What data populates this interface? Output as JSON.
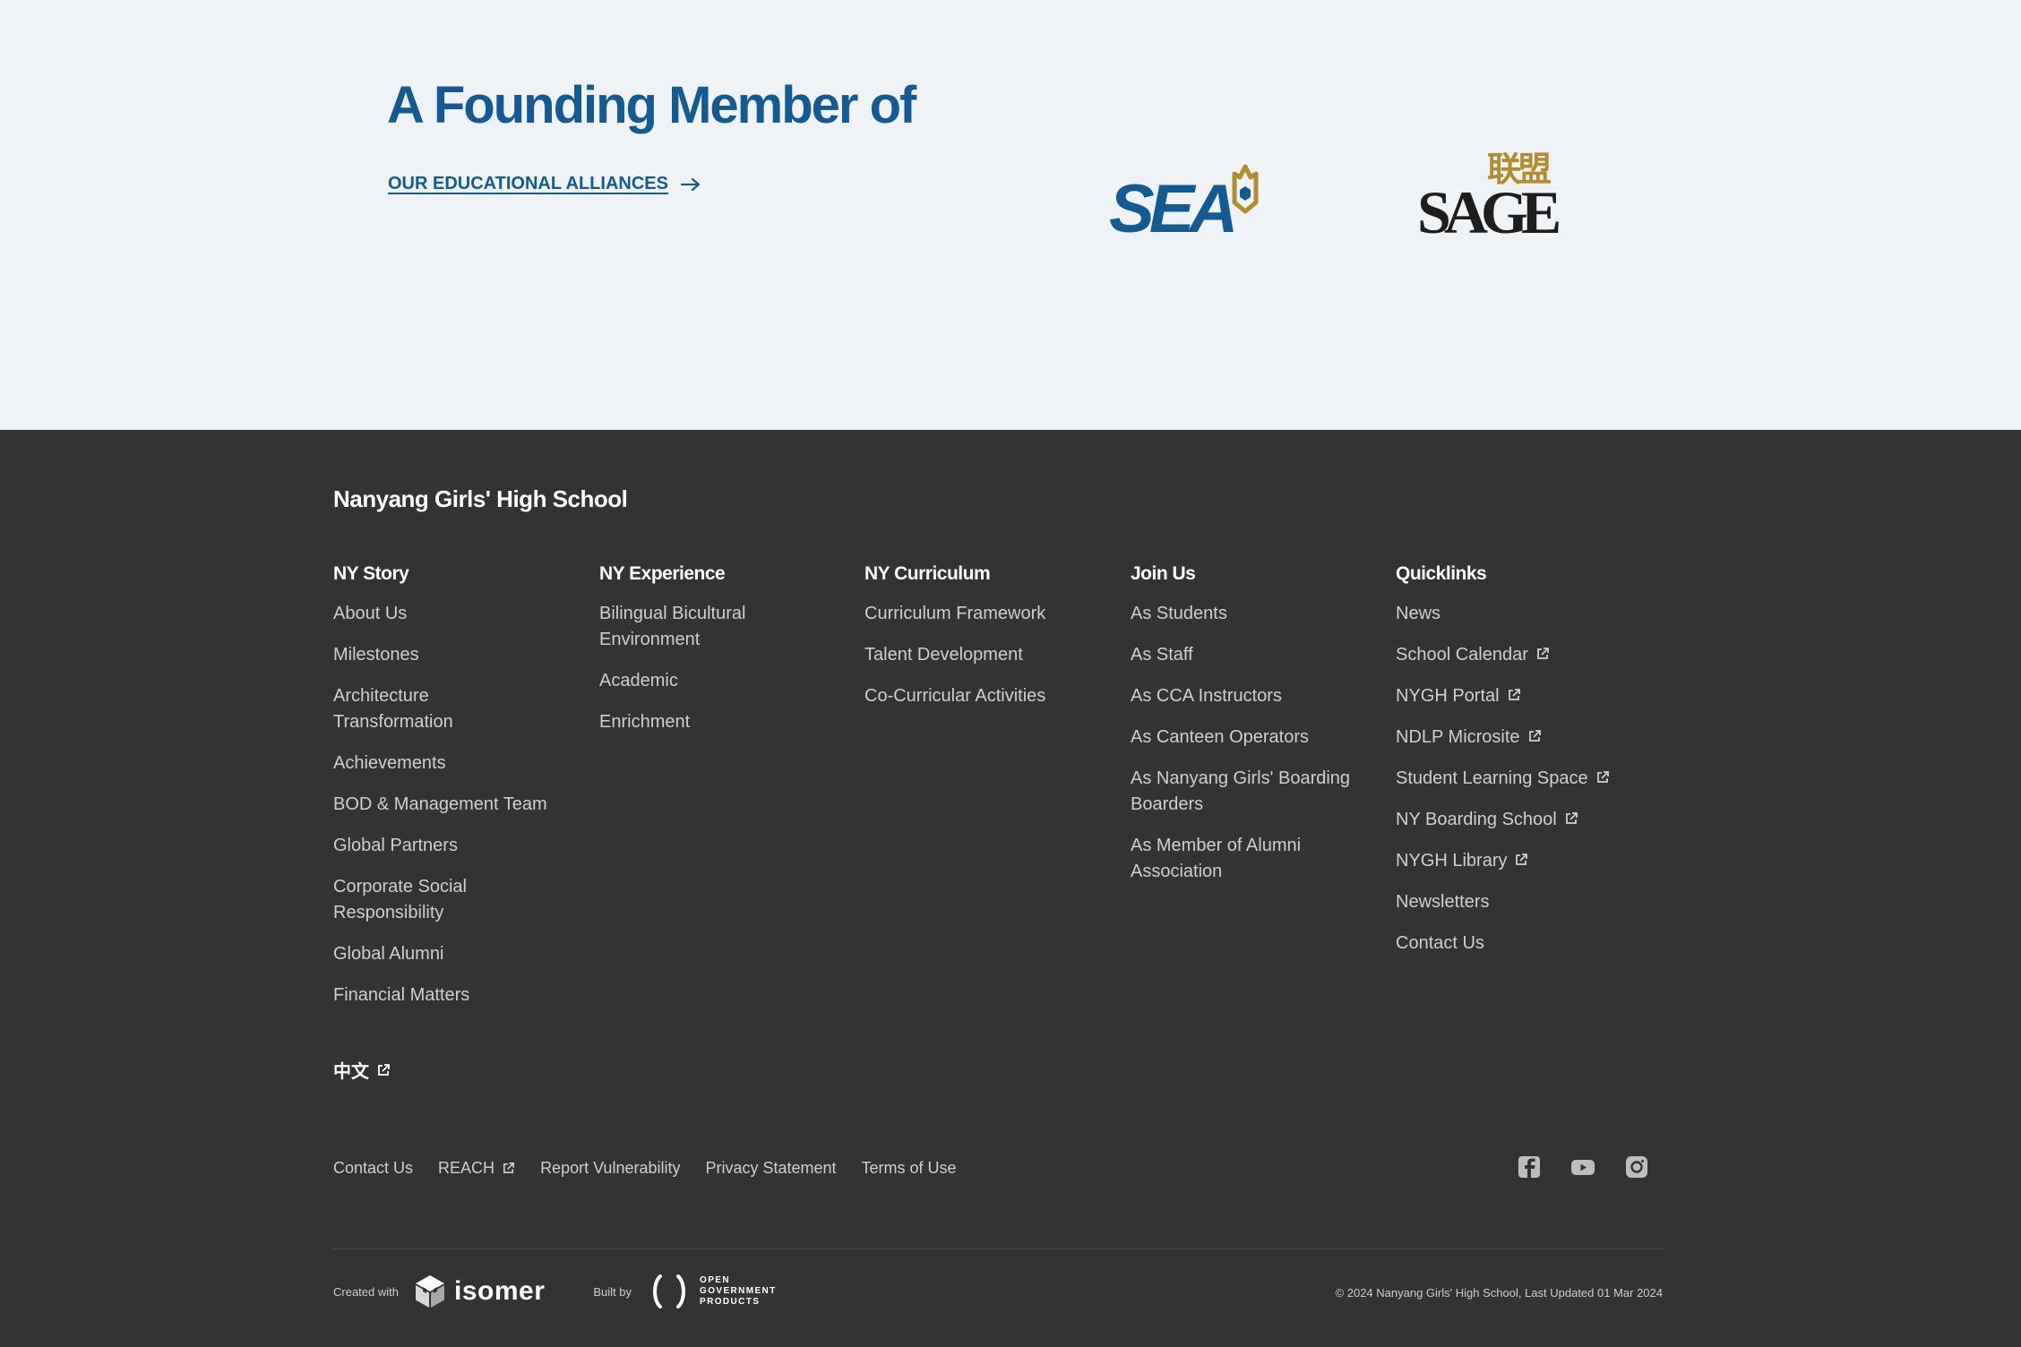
{
  "alliance": {
    "title": "A Founding Member of",
    "link_label": "OUR EDUCATIONAL ALLIANCES",
    "logos": [
      {
        "name": "SEA",
        "text": "SEA"
      },
      {
        "name": "SAGE",
        "text": "SAGE",
        "cjk": "联盟"
      }
    ],
    "brand_color": "#155a92",
    "gold_color": "#b08d2e"
  },
  "footer": {
    "school_name": "Nanyang Girls' High School",
    "columns": [
      {
        "heading": "NY Story",
        "items": [
          {
            "label": "About Us"
          },
          {
            "label": "Milestones"
          },
          {
            "label": "Architecture Transformation"
          },
          {
            "label": "Achievements"
          },
          {
            "label": "BOD & Management Team"
          },
          {
            "label": "Global Partners"
          },
          {
            "label": "Corporate Social Responsibility"
          },
          {
            "label": "Global Alumni"
          },
          {
            "label": "Financial Matters"
          }
        ]
      },
      {
        "heading": "NY Experience",
        "items": [
          {
            "label": "Bilingual Bicultural Environment"
          },
          {
            "label": "Academic"
          },
          {
            "label": "Enrichment"
          }
        ]
      },
      {
        "heading": "NY Curriculum",
        "items": [
          {
            "label": "Curriculum Framework"
          },
          {
            "label": "Talent Development"
          },
          {
            "label": "Co-Curricular Activities"
          }
        ]
      },
      {
        "heading": "Join Us",
        "items": [
          {
            "label": "As Students"
          },
          {
            "label": "As Staff"
          },
          {
            "label": "As CCA Instructors"
          },
          {
            "label": "As Canteen Operators"
          },
          {
            "label": "As Nanyang Girls' Boarding Boarders"
          },
          {
            "label": "As Member of Alumni Association"
          }
        ]
      },
      {
        "heading": "Quicklinks",
        "items": [
          {
            "label": "News"
          },
          {
            "label": "School Calendar",
            "external": true
          },
          {
            "label": "NYGH Portal",
            "external": true
          },
          {
            "label": "NDLP Microsite",
            "external": true
          },
          {
            "label": "Student Learning Space",
            "external": true
          },
          {
            "label": "NY Boarding School",
            "external": true
          },
          {
            "label": "NYGH Library",
            "external": true
          },
          {
            "label": "Newsletters"
          },
          {
            "label": "Contact Us"
          }
        ]
      }
    ],
    "language_link": "中文",
    "bottom_links": [
      {
        "label": "Contact Us"
      },
      {
        "label": "REACH",
        "external": true
      },
      {
        "label": "Report Vulnerability"
      },
      {
        "label": "Privacy Statement"
      },
      {
        "label": "Terms of Use"
      }
    ],
    "social": [
      "facebook-icon",
      "youtube-icon",
      "instagram-icon"
    ],
    "created_with_label": "Created with",
    "isomer_label": "isomer",
    "built_by_label": "Built by",
    "ogp_label": "OPEN\nGOVERNMENT\nPRODUCTS",
    "copyright": "© 2024 Nanyang Girls' High School, Last Updated 01 Mar 2024"
  }
}
